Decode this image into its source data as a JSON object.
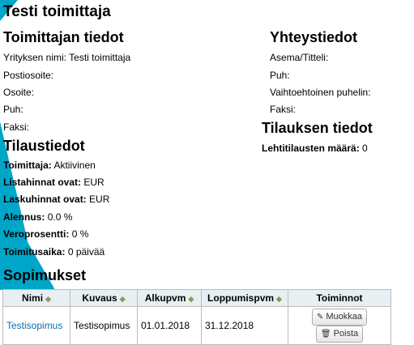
{
  "page_title": "Testi toimittaja",
  "vendor_info": {
    "heading": "Toimittajan tiedot",
    "company_label": "Yrityksen nimi:",
    "company_value": "Testi toimittaja",
    "postal_label": "Postiosoite:",
    "address_label": "Osoite:",
    "phone_label": "Puh:",
    "fax_label": "Faksi:"
  },
  "contact_info": {
    "heading": "Yhteystiedot",
    "position_label": "Asema/Titteli:",
    "phone_label": "Puh:",
    "alt_phone_label": "Vaihtoehtoinen puhelin:",
    "fax_label": "Faksi:"
  },
  "order_info": {
    "heading": "Tilaustiedot",
    "vendor_label": "Toimittaja:",
    "vendor_value": "Aktiivinen",
    "list_prices_label": "Listahinnat ovat:",
    "list_prices_value": "EUR",
    "invoice_prices_label": "Laskuhinnat ovat:",
    "invoice_prices_value": "EUR",
    "discount_label": "Alennus:",
    "discount_value": "0.0 %",
    "tax_label": "Veroprosentti:",
    "tax_value": "0 %",
    "delivery_label": "Toimitusaika:",
    "delivery_value": "0 päivää"
  },
  "order_details": {
    "heading": "Tilauksen tiedot",
    "subscription_count_label": "Lehtitilausten määrä:",
    "subscription_count_value": "0"
  },
  "contracts": {
    "heading": "Sopimukset",
    "columns": [
      "Nimi",
      "Kuvaus",
      "Alkupvm",
      "Loppumispvm",
      "Toiminnot"
    ],
    "rows": [
      {
        "name": "Testisopimus",
        "description": "Testisopimus",
        "start": "01.01.2018",
        "end": "31.12.2018",
        "edit_label": "Muokkaa",
        "delete_label": "Poista"
      }
    ]
  },
  "colors": {
    "accent": "#00a6c8",
    "link": "#0b6fa8",
    "header_bg": "#e6f0f2"
  }
}
